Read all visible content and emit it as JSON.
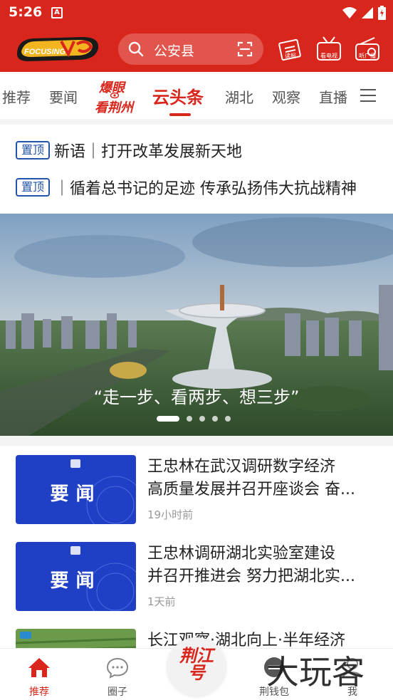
{
  "status_bar": {
    "time": "5:26",
    "notif_letter": "A"
  },
  "header": {
    "logo_text": "FOCUSING",
    "search_value": "公安县",
    "icons": [
      {
        "name": "read-newspaper-icon",
        "label": "读报"
      },
      {
        "name": "watch-tv-icon",
        "label": "看电视"
      },
      {
        "name": "listen-radio-icon",
        "label": "听广播"
      }
    ]
  },
  "tabs": {
    "items": [
      "推荐",
      "要闻",
      "云头条",
      "湖北",
      "观察",
      "直播"
    ],
    "special_line1": "爆眼",
    "special_line2": "看荆州",
    "active": "云头条"
  },
  "pinned": [
    {
      "badge": "置顶",
      "text": "新语｜打开改革发展新天地"
    },
    {
      "badge": "置顶",
      "text": "｜循着总书记的足迹 传承弘扬伟大抗战精神"
    }
  ],
  "banner": {
    "caption": "“走一步、看两步、想三步”",
    "slide_count": 5,
    "active_slide": 1
  },
  "news": [
    {
      "thumb_label": "要闻",
      "title_lines": [
        "王忠林在武汉调研数字经济",
        "高质量发展并召开座谈会 奋..."
      ],
      "time": "19小时前"
    },
    {
      "thumb_label": "要闻",
      "title_lines": [
        "王忠林调研湖北实验室建设",
        "并召开推进会 努力把湖北实..."
      ],
      "time": "1天前"
    },
    {
      "thumb_label": "",
      "title_lines": [
        "长江观察·湖北向上·半年经济"
      ],
      "time": ""
    }
  ],
  "bottom_nav": {
    "items": [
      {
        "label": "推荐",
        "icon": "home-icon",
        "active": true
      },
      {
        "label": "圈子",
        "icon": "chat-bubble-icon",
        "active": false
      },
      {
        "label": "荆钱包",
        "icon": "wallet-icon",
        "active": false
      },
      {
        "label": "我",
        "icon": "user-icon",
        "active": false
      }
    ],
    "center_line1": "荆江",
    "center_line2": "号"
  },
  "watermark": "大玩客",
  "colors": {
    "brand_red": "#d9261c",
    "pin_blue": "#2255aa",
    "thumb_blue": "#1f3fc4"
  }
}
